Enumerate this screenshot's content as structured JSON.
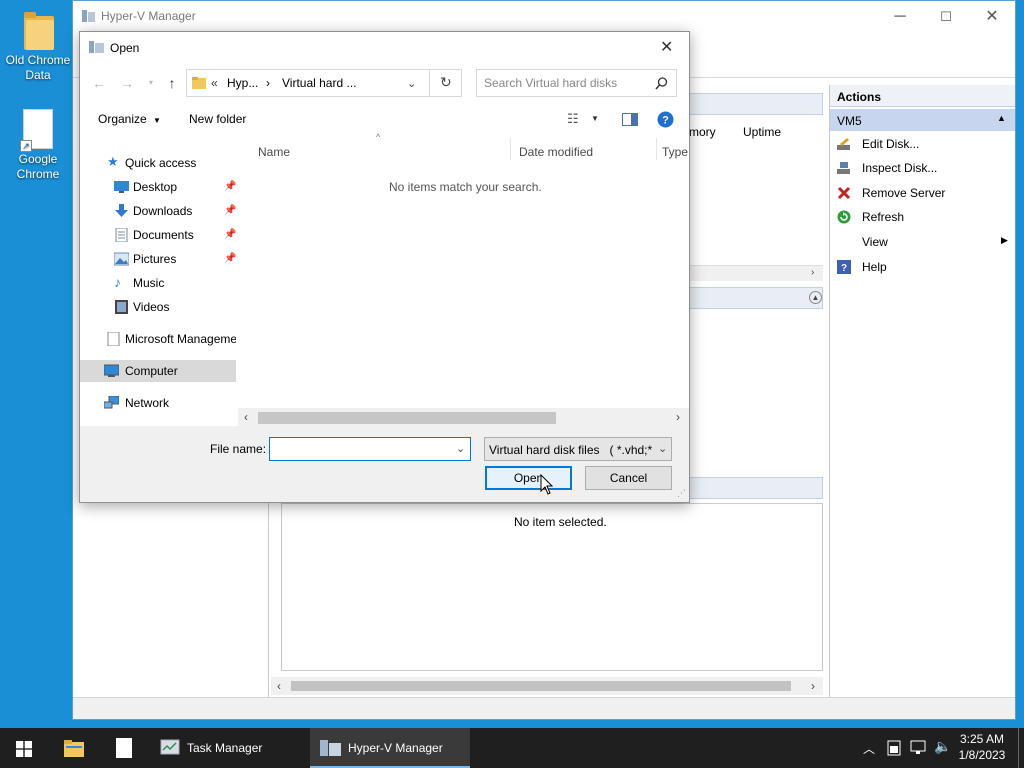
{
  "desktop": {
    "icons": [
      {
        "label_line1": "Old Chrome",
        "label_line2": "Data",
        "icon": "folder-icon"
      },
      {
        "label_line1": "Google",
        "label_line2": "Chrome",
        "icon": "shortcut-icon"
      }
    ]
  },
  "hyperv": {
    "title": "Hyper-V Manager",
    "columns": {
      "memory": "mory",
      "uptime": "Uptime"
    },
    "details_empty": "No item selected.",
    "actions": {
      "title": "Actions",
      "vm_name": "VM5",
      "items": [
        {
          "label": "Edit Disk...",
          "icon": "edit-disk-icon"
        },
        {
          "label": "Inspect Disk...",
          "icon": "inspect-disk-icon"
        },
        {
          "label": "Remove Server",
          "icon": "remove-icon"
        },
        {
          "label": "Refresh",
          "icon": "refresh-icon"
        },
        {
          "label": "View",
          "icon": ""
        },
        {
          "label": "Help",
          "icon": "help-icon"
        }
      ]
    }
  },
  "dialog": {
    "title": "Open",
    "breadcrumb": {
      "prefix": "«",
      "segment1": "Hyp...",
      "separator": "›",
      "segment2": "Virtual hard ..."
    },
    "search_placeholder": "Search Virtual hard disks",
    "organize_label": "Organize",
    "new_folder_label": "New folder",
    "columns": {
      "name": "Name",
      "date_modified": "Date modified",
      "type": "Type"
    },
    "empty_message": "No items match your search.",
    "nav": {
      "quick_access": "Quick access",
      "items": [
        {
          "label": "Desktop",
          "icon": "desktop-icon"
        },
        {
          "label": "Downloads",
          "icon": "downloads-icon"
        },
        {
          "label": "Documents",
          "icon": "documents-icon"
        },
        {
          "label": "Pictures",
          "icon": "pictures-icon"
        },
        {
          "label": "Music",
          "icon": "music-icon"
        },
        {
          "label": "Videos",
          "icon": "videos-icon"
        }
      ],
      "microsoft_management": "Microsoft Manageme",
      "computer": "Computer",
      "network": "Network"
    },
    "file_name_label": "File name:",
    "file_name_value": "",
    "file_type": "Virtual hard disk files   ( *.vhd;*.",
    "open_label": "Open",
    "cancel_label": "Cancel"
  },
  "taskbar": {
    "apps": [
      {
        "label": "Task Manager"
      },
      {
        "label": "Hyper-V Manager"
      }
    ],
    "time": "3:25 AM",
    "date": "1/8/2023"
  },
  "colors": {
    "desktop_bg": "#1a8fd6",
    "accent": "#0078d7",
    "selection": "#cce8ff",
    "taskbar_bg": "#1f1f1f"
  }
}
